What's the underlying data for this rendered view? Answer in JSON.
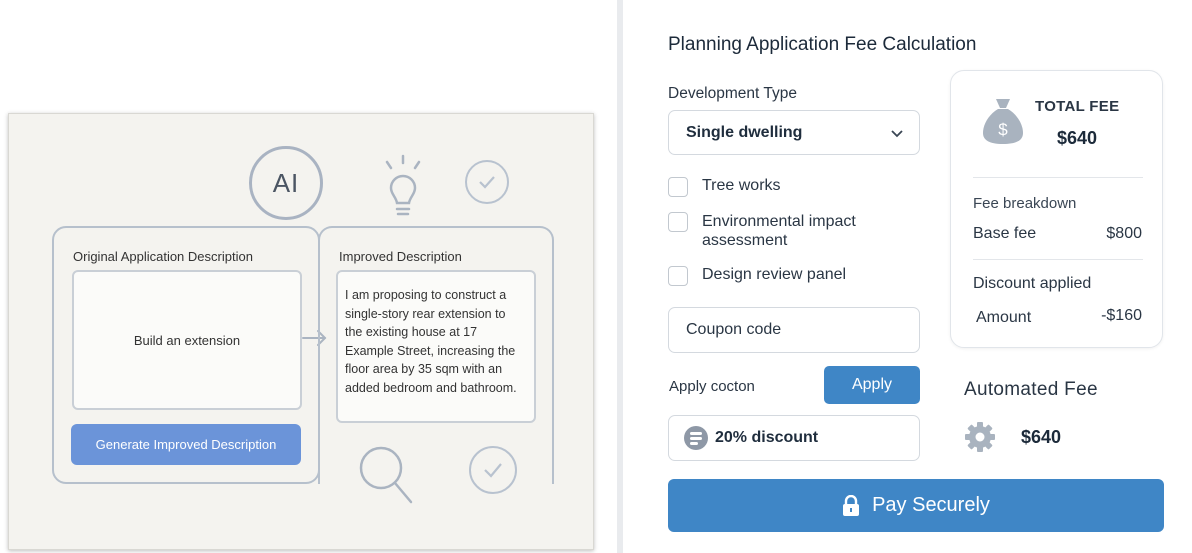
{
  "left": {
    "ai_badge": "AI",
    "original": {
      "title": "Original Application Description",
      "text": "Build an extension",
      "button": "Generate Improved Description"
    },
    "improved": {
      "title": "Improved Description",
      "text": "I am proposing to construct a single-story rear extension to the existing house at 17 Example Street, increasing the floor area by 35 sqm with an added bedroom and bathroom."
    },
    "icons": [
      "brain-ai-icon",
      "lightbulb-icon",
      "check-circle-icon",
      "arrow-right-icon",
      "magnifier-icon",
      "check-circle-icon"
    ]
  },
  "right": {
    "title": "Planning Application Fee Calculation",
    "development_type": {
      "label": "Development Type",
      "value": "Single dwelling"
    },
    "options": [
      {
        "label": "Tree works",
        "checked": false
      },
      {
        "label": "Environmental impact assessment",
        "checked": false
      },
      {
        "label": "Design review panel",
        "checked": false
      }
    ],
    "coupon": {
      "placeholder": "Coupon code"
    },
    "apply": {
      "label": "Apply cocton",
      "button": "Apply"
    },
    "discount_pill": "20% discount",
    "fee_card": {
      "total_label": "TOTAL FEE",
      "total_value": "$640",
      "breakdown_label": "Fee breakdown",
      "base_label": "Base fee",
      "base_value": "$800",
      "discount_label": "Discount applied",
      "amount_label": "Amount",
      "amount_value": "-$160"
    },
    "automated": {
      "label": "Automated Fee",
      "value": "$640"
    },
    "pay_button": "Pay Securely",
    "colors": {
      "accent": "#3f86c6",
      "generate_button": "#6b94d9"
    }
  }
}
